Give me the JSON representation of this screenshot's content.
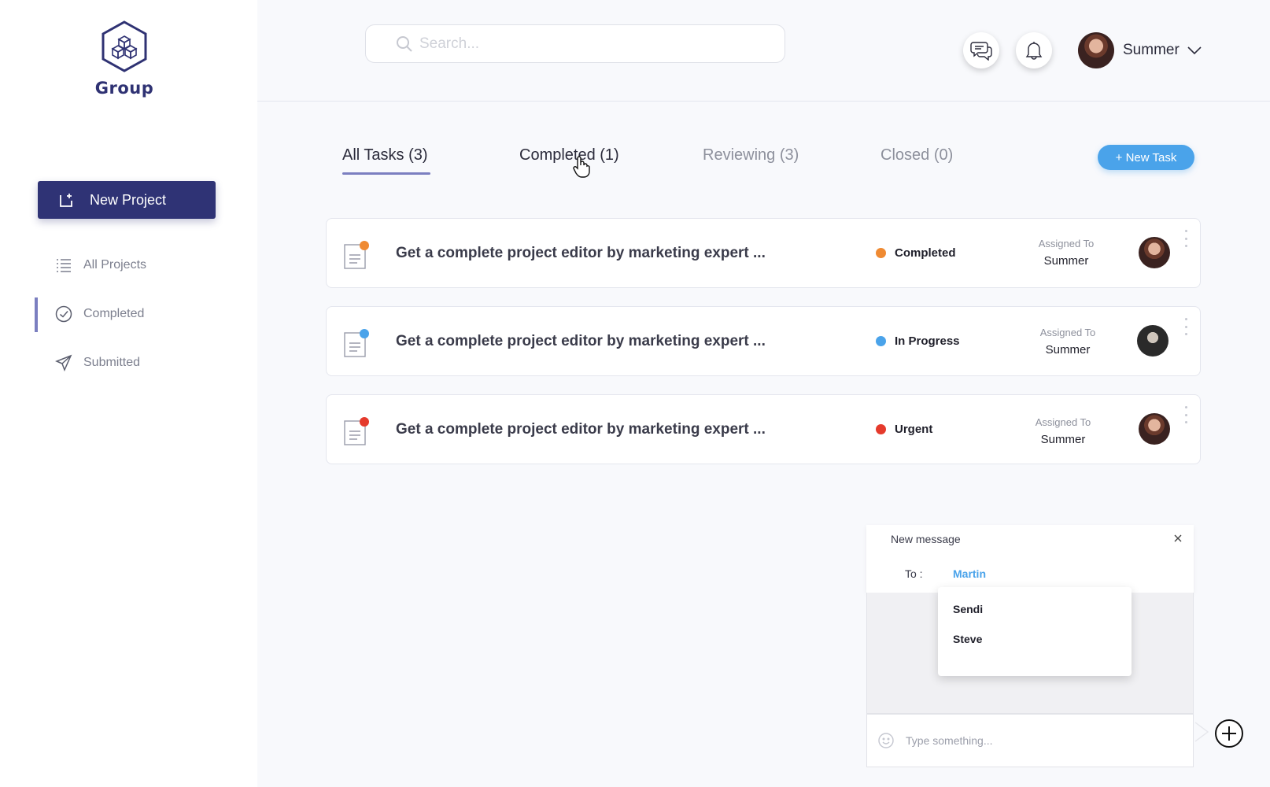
{
  "brand": {
    "name": "Group",
    "logo_icon": "cubes-hexagon-icon"
  },
  "sidebar": {
    "new_project_label": "New Project",
    "items": [
      {
        "label": "All Projects",
        "icon": "list-icon",
        "active": false
      },
      {
        "label": "Completed",
        "icon": "check-circle-icon",
        "active": true
      },
      {
        "label": "Submitted",
        "icon": "paper-plane-icon",
        "active": false
      }
    ],
    "accent_color": "#2f3375"
  },
  "header": {
    "search_placeholder": "Search...",
    "chat_icon": "chat-bubbles-icon",
    "bell_icon": "bell-icon",
    "user_name": "Summer"
  },
  "tabs": [
    {
      "label": "All Tasks (3)",
      "active": true
    },
    {
      "label": "Completed (1)",
      "active": false
    },
    {
      "label": "Reviewing (3)",
      "active": false
    },
    {
      "label": "Closed (0)",
      "active": false
    }
  ],
  "new_task_label": "+ New Task",
  "tasks": [
    {
      "title": "Get a complete project editor by marketing expert ...",
      "status": "Completed",
      "status_color": "#ef8a32",
      "assigned_label": "Assigned To",
      "assignee": "Summer"
    },
    {
      "title": "Get a complete project editor by marketing expert ...",
      "status": "In Progress",
      "status_color": "#4aa3ea",
      "assigned_label": "Assigned To",
      "assignee": "Summer"
    },
    {
      "title": "Get a complete project editor by marketing expert ...",
      "status": "Urgent",
      "status_color": "#e53a2c",
      "assigned_label": "Assigned To",
      "assignee": "Summer"
    }
  ],
  "message": {
    "title": "New message",
    "to_label": "To :",
    "recipient": "Martin",
    "suggestions": [
      "Sendi",
      "Steve"
    ],
    "input_placeholder": "Type something..."
  }
}
